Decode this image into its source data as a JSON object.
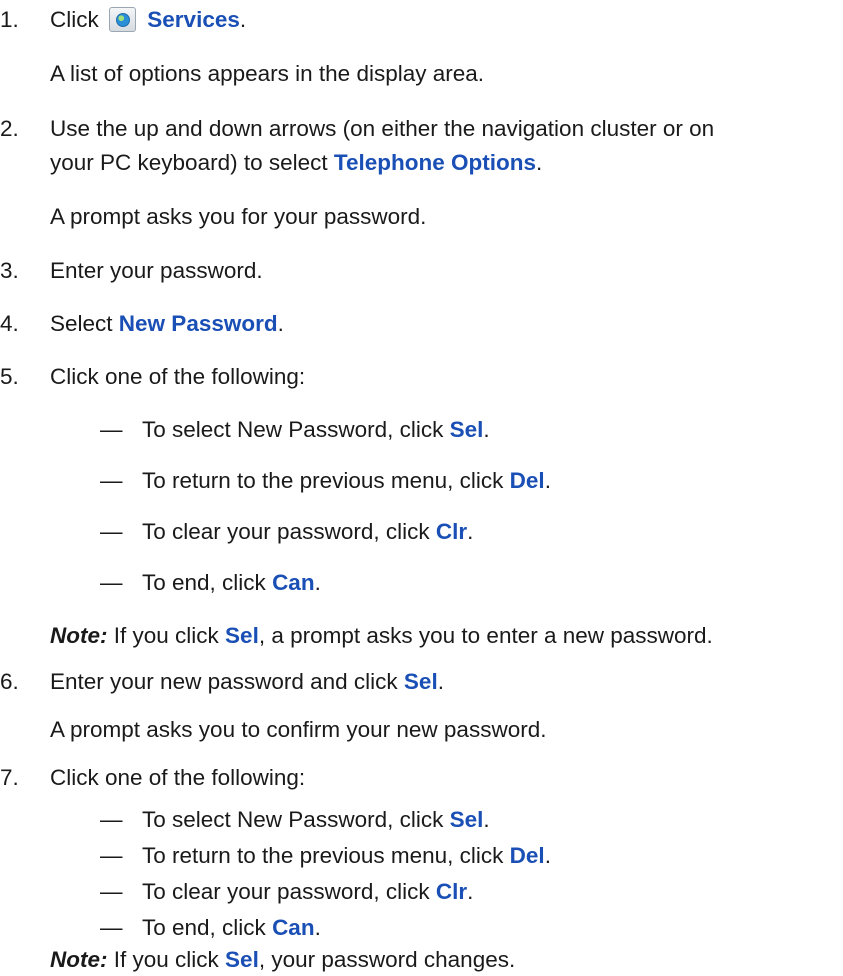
{
  "steps": [
    {
      "num": "1.",
      "pre": "Click",
      "kw": "Services",
      "post": ".",
      "icon": "globe-services-icon"
    },
    {
      "result": "A  list of options appears in the display area."
    },
    {
      "num": "2.",
      "line1": "Use the up and down arrows (on either the navigation cluster or on",
      "line2_pre": "your PC keyboard) to select ",
      "kw": "Telephone Options",
      "post": "."
    },
    {
      "result": "A prompt asks you for your password."
    },
    {
      "num": "3.",
      "text": "Enter your password."
    },
    {
      "num": "4.",
      "pre": "Select ",
      "kw": "New Password",
      "post": "."
    },
    {
      "num": "5.",
      "text": "Click one of the following:"
    },
    {
      "num": "6.",
      "pre": "Enter your new password and click ",
      "kw": "Sel",
      "post": "."
    },
    {
      "result": "A prompt asks you to confirm your new password."
    },
    {
      "num": "7.",
      "text": "Click one of the following:"
    }
  ],
  "options_a": [
    {
      "dash": "—",
      "pre": "To select New Password, click ",
      "kw": "Sel",
      "post": "."
    },
    {
      "dash": "—",
      "pre": "To return to the previous menu, click ",
      "kw": "Del",
      "post": "."
    },
    {
      "dash": "—",
      "pre": "To clear your password, click ",
      "kw": "Clr",
      "post": "."
    },
    {
      "dash": "—",
      "pre": "To end, click ",
      "kw": "Can",
      "post": "."
    }
  ],
  "note_a": {
    "label": "Note:",
    "pre": " If you click ",
    "kw": "Sel",
    "post": ", a prompt asks you to enter a new password."
  },
  "options_b": [
    {
      "dash": "—",
      "pre": "To select New Password, click ",
      "kw": "Sel",
      "post": "."
    },
    {
      "dash": "—",
      "pre": "To return to the previous menu, click ",
      "kw": "Del",
      "post": "."
    },
    {
      "dash": "—",
      "pre": "To clear your password, click ",
      "kw": "Clr",
      "post": "."
    },
    {
      "dash": "—",
      "pre": "To end, click ",
      "kw": "Can",
      "post": "."
    }
  ],
  "note_b": {
    "label": "Note:",
    "pre": " If you click ",
    "kw": "Sel",
    "post": ", your password changes."
  },
  "colors": {
    "keyword": "#1a4fb5",
    "text": "#1a1a1a"
  }
}
